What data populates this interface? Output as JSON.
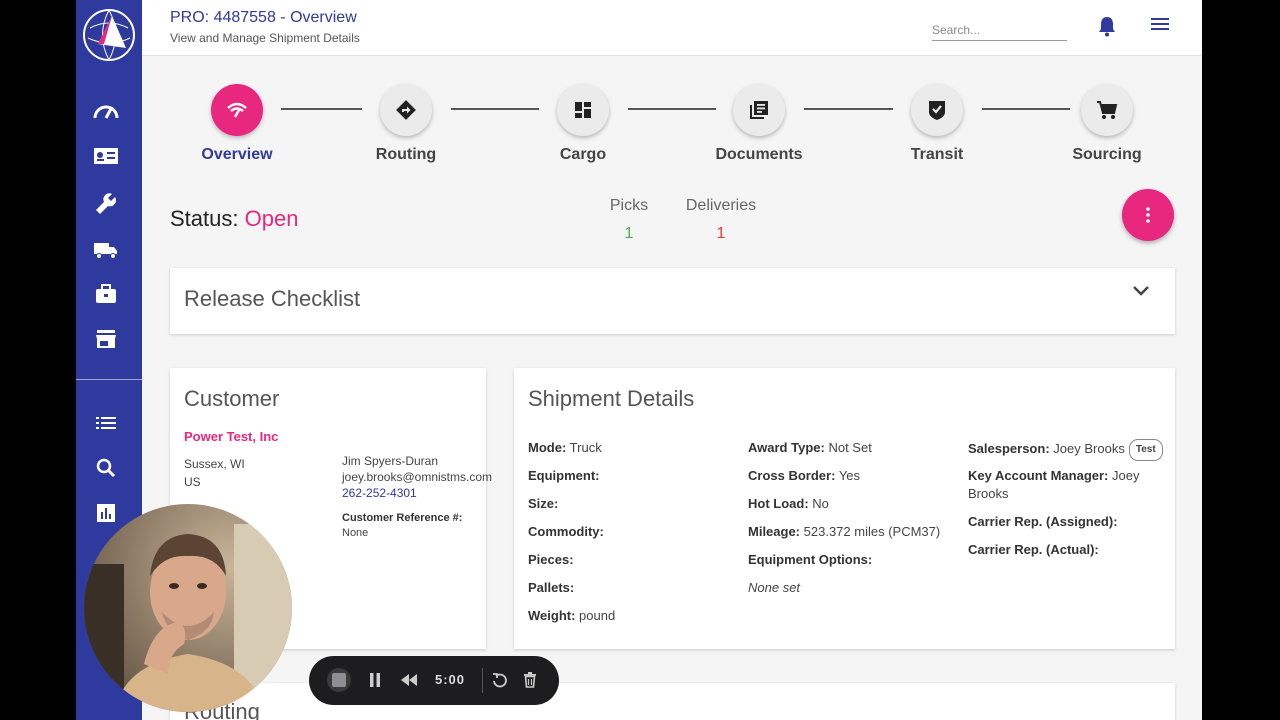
{
  "header": {
    "title": "PRO: 4487558 - Overview",
    "subtitle": "View and Manage Shipment Details",
    "search_placeholder": "Search..."
  },
  "sidebar": {
    "top_icons": [
      "speedometer-icon",
      "id-card-icon",
      "wrench-icon",
      "truck-icon",
      "briefcase-icon",
      "storefront-icon"
    ],
    "bottom_icons": [
      "list-icon",
      "search-icon",
      "bar-chart-icon"
    ]
  },
  "steps": [
    {
      "label": "Overview",
      "icon": "overview-icon",
      "active": true
    },
    {
      "label": "Routing",
      "icon": "routing-icon",
      "active": false
    },
    {
      "label": "Cargo",
      "icon": "dashboard-icon",
      "active": false
    },
    {
      "label": "Documents",
      "icon": "documents-icon",
      "active": false
    },
    {
      "label": "Transit",
      "icon": "shield-check-icon",
      "active": false
    },
    {
      "label": "Sourcing",
      "icon": "cart-icon",
      "active": false
    }
  ],
  "status": {
    "label": "Status:",
    "value": "Open"
  },
  "counts": {
    "picks_label": "Picks",
    "picks_value": "1",
    "deliveries_label": "Deliveries",
    "deliveries_value": "1"
  },
  "release_checklist": {
    "title": "Release Checklist"
  },
  "customer": {
    "title": "Customer",
    "name": "Power Test, Inc",
    "city": "Sussex, WI",
    "country": "US",
    "contact_name": "Jim Spyers-Duran",
    "contact_email": "joey.brooks@omnistms.com",
    "contact_phone": "262-252-4301",
    "ref_label": "Customer Reference #:",
    "ref_value": "None"
  },
  "shipment": {
    "title": "Shipment Details",
    "col1": [
      {
        "label": "Mode:",
        "value": "Truck"
      },
      {
        "label": "Equipment:",
        "value": ""
      },
      {
        "label": "Size:",
        "value": ""
      },
      {
        "label": "Commodity:",
        "value": ""
      },
      {
        "label": "Pieces:",
        "value": ""
      },
      {
        "label": "Pallets:",
        "value": ""
      },
      {
        "label": "Weight:",
        "value": "pound"
      }
    ],
    "col2": [
      {
        "label": "Award Type:",
        "value": "Not Set"
      },
      {
        "label": "Cross Border:",
        "value": "Yes"
      },
      {
        "label": "Hot Load:",
        "value": "No"
      },
      {
        "label": "Mileage:",
        "value": "523.372 miles (PCM37)"
      },
      {
        "label": "Equipment Options:",
        "value": ""
      }
    ],
    "equipment_options_value": "None set",
    "salesperson_label": "Salesperson:",
    "salesperson_value": "Joey Brooks",
    "salesperson_badge": "Test",
    "kam_label": "Key Account Manager:",
    "kam_value": "Joey Brooks",
    "carrier_assigned_label": "Carrier Rep. (Assigned):",
    "carrier_actual_label": "Carrier Rep. (Actual):"
  },
  "routing_section": {
    "title": "Routing"
  },
  "recorder": {
    "time": "5:00"
  },
  "colors": {
    "primary": "#2f3a9e",
    "accent": "#e8277e",
    "picks": "#4caf50",
    "deliveries": "#e53935"
  }
}
